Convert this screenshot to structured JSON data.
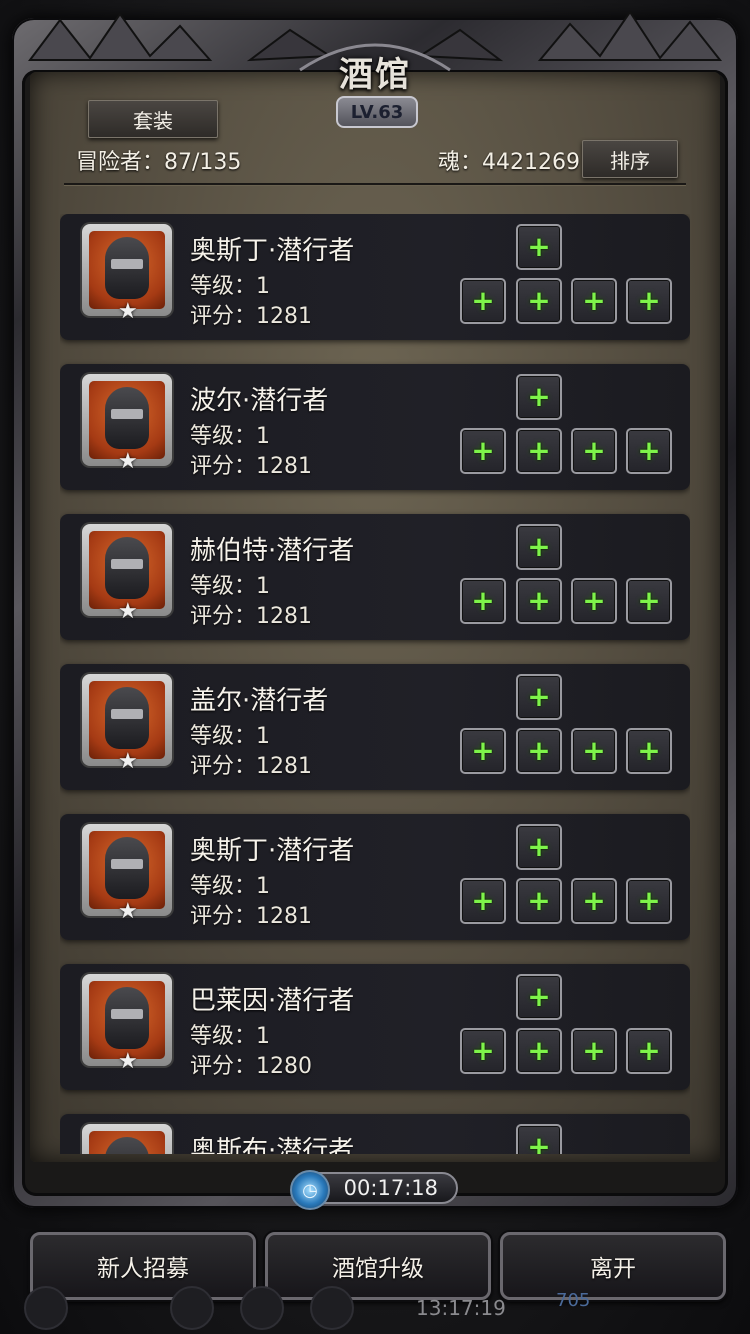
{
  "title": "酒馆",
  "level": "LV.63",
  "suit_button": "套装",
  "sort_button": "排序",
  "adventurers": "冒险者：87/135",
  "soul": "魂：4421269",
  "heroes": [
    {
      "name": "奥斯丁·潜行者",
      "level": "等级：1",
      "score": "评分：1281"
    },
    {
      "name": "波尔·潜行者",
      "level": "等级：1",
      "score": "评分：1281"
    },
    {
      "name": "赫伯特·潜行者",
      "level": "等级：1",
      "score": "评分：1281"
    },
    {
      "name": "盖尔·潜行者",
      "level": "等级：1",
      "score": "评分：1281"
    },
    {
      "name": "奥斯丁·潜行者",
      "level": "等级：1",
      "score": "评分：1281"
    },
    {
      "name": "巴莱因·潜行者",
      "level": "等级：1",
      "score": "评分：1280"
    },
    {
      "name": "奥斯布·潜行者",
      "level": "",
      "score": ""
    }
  ],
  "slot_icon": "+",
  "timer": "00:17:18",
  "buttons": {
    "recruit": "新人招募",
    "upgrade": "酒馆升级",
    "leave": "离开"
  },
  "status_time": "13:17:19",
  "status_number": "705",
  "colors": {
    "plus_green": "#7ef44a",
    "portrait_orange": "#a53a14"
  }
}
